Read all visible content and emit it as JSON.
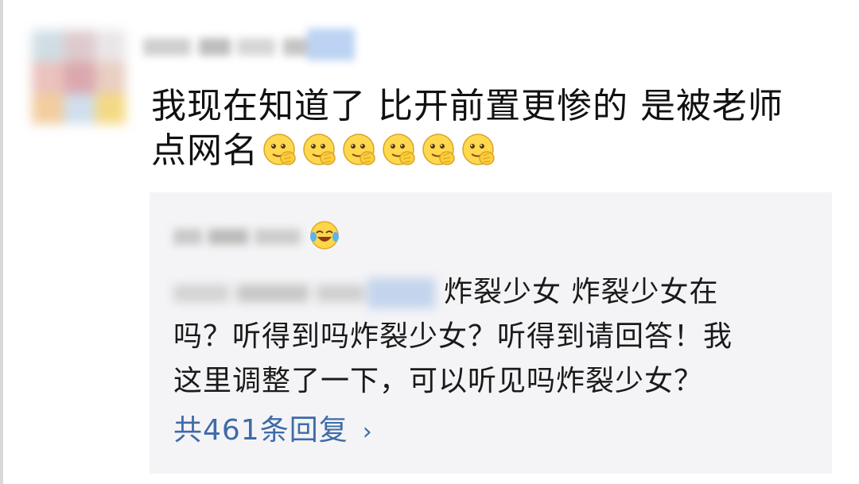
{
  "comment": {
    "text_line1": "我现在知道了 比开前置更惨的 是被老师",
    "text_line2": "点网名",
    "emoji_count": 6,
    "emoji_name": "facepalm-smile-emoji"
  },
  "reply": {
    "text_part1": "炸裂少女 炸裂少女在",
    "text_line2": "吗？听得到吗炸裂少女？听得到请回答！我",
    "text_line3": "这里调整了一下，可以听见吗炸裂少女？",
    "author_emoji": "laughing-tears-emoji",
    "count_label": "共461条回复",
    "chevron": "›"
  },
  "colors": {
    "background": "#ffffff",
    "panel": "#f4f4f6",
    "text": "#111111",
    "link": "#3f6ba8"
  }
}
